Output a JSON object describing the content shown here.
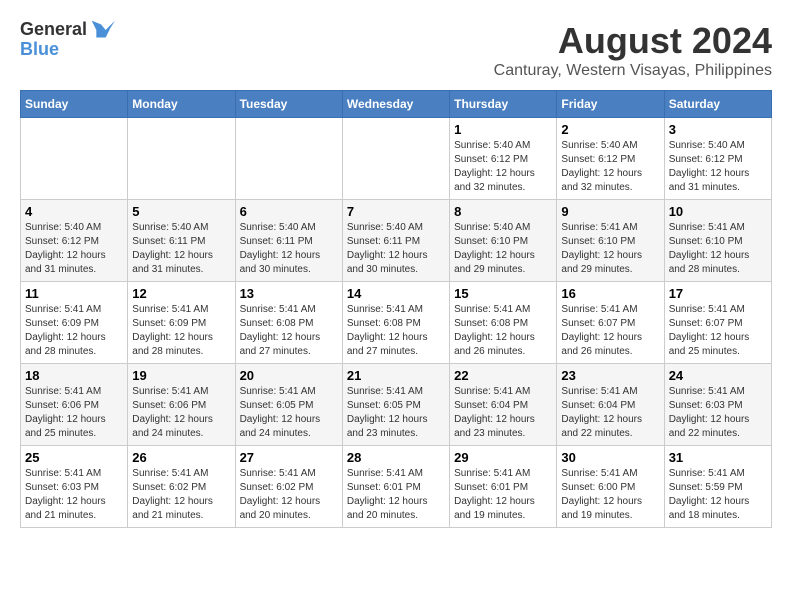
{
  "header": {
    "logo_line1": "General",
    "logo_line2": "Blue",
    "month_year": "August 2024",
    "location": "Canturay, Western Visayas, Philippines"
  },
  "days_of_week": [
    "Sunday",
    "Monday",
    "Tuesday",
    "Wednesday",
    "Thursday",
    "Friday",
    "Saturday"
  ],
  "weeks": [
    [
      {
        "day": "",
        "info": ""
      },
      {
        "day": "",
        "info": ""
      },
      {
        "day": "",
        "info": ""
      },
      {
        "day": "",
        "info": ""
      },
      {
        "day": "1",
        "info": "Sunrise: 5:40 AM\nSunset: 6:12 PM\nDaylight: 12 hours\nand 32 minutes."
      },
      {
        "day": "2",
        "info": "Sunrise: 5:40 AM\nSunset: 6:12 PM\nDaylight: 12 hours\nand 32 minutes."
      },
      {
        "day": "3",
        "info": "Sunrise: 5:40 AM\nSunset: 6:12 PM\nDaylight: 12 hours\nand 31 minutes."
      }
    ],
    [
      {
        "day": "4",
        "info": "Sunrise: 5:40 AM\nSunset: 6:12 PM\nDaylight: 12 hours\nand 31 minutes."
      },
      {
        "day": "5",
        "info": "Sunrise: 5:40 AM\nSunset: 6:11 PM\nDaylight: 12 hours\nand 31 minutes."
      },
      {
        "day": "6",
        "info": "Sunrise: 5:40 AM\nSunset: 6:11 PM\nDaylight: 12 hours\nand 30 minutes."
      },
      {
        "day": "7",
        "info": "Sunrise: 5:40 AM\nSunset: 6:11 PM\nDaylight: 12 hours\nand 30 minutes."
      },
      {
        "day": "8",
        "info": "Sunrise: 5:40 AM\nSunset: 6:10 PM\nDaylight: 12 hours\nand 29 minutes."
      },
      {
        "day": "9",
        "info": "Sunrise: 5:41 AM\nSunset: 6:10 PM\nDaylight: 12 hours\nand 29 minutes."
      },
      {
        "day": "10",
        "info": "Sunrise: 5:41 AM\nSunset: 6:10 PM\nDaylight: 12 hours\nand 28 minutes."
      }
    ],
    [
      {
        "day": "11",
        "info": "Sunrise: 5:41 AM\nSunset: 6:09 PM\nDaylight: 12 hours\nand 28 minutes."
      },
      {
        "day": "12",
        "info": "Sunrise: 5:41 AM\nSunset: 6:09 PM\nDaylight: 12 hours\nand 28 minutes."
      },
      {
        "day": "13",
        "info": "Sunrise: 5:41 AM\nSunset: 6:08 PM\nDaylight: 12 hours\nand 27 minutes."
      },
      {
        "day": "14",
        "info": "Sunrise: 5:41 AM\nSunset: 6:08 PM\nDaylight: 12 hours\nand 27 minutes."
      },
      {
        "day": "15",
        "info": "Sunrise: 5:41 AM\nSunset: 6:08 PM\nDaylight: 12 hours\nand 26 minutes."
      },
      {
        "day": "16",
        "info": "Sunrise: 5:41 AM\nSunset: 6:07 PM\nDaylight: 12 hours\nand 26 minutes."
      },
      {
        "day": "17",
        "info": "Sunrise: 5:41 AM\nSunset: 6:07 PM\nDaylight: 12 hours\nand 25 minutes."
      }
    ],
    [
      {
        "day": "18",
        "info": "Sunrise: 5:41 AM\nSunset: 6:06 PM\nDaylight: 12 hours\nand 25 minutes."
      },
      {
        "day": "19",
        "info": "Sunrise: 5:41 AM\nSunset: 6:06 PM\nDaylight: 12 hours\nand 24 minutes."
      },
      {
        "day": "20",
        "info": "Sunrise: 5:41 AM\nSunset: 6:05 PM\nDaylight: 12 hours\nand 24 minutes."
      },
      {
        "day": "21",
        "info": "Sunrise: 5:41 AM\nSunset: 6:05 PM\nDaylight: 12 hours\nand 23 minutes."
      },
      {
        "day": "22",
        "info": "Sunrise: 5:41 AM\nSunset: 6:04 PM\nDaylight: 12 hours\nand 23 minutes."
      },
      {
        "day": "23",
        "info": "Sunrise: 5:41 AM\nSunset: 6:04 PM\nDaylight: 12 hours\nand 22 minutes."
      },
      {
        "day": "24",
        "info": "Sunrise: 5:41 AM\nSunset: 6:03 PM\nDaylight: 12 hours\nand 22 minutes."
      }
    ],
    [
      {
        "day": "25",
        "info": "Sunrise: 5:41 AM\nSunset: 6:03 PM\nDaylight: 12 hours\nand 21 minutes."
      },
      {
        "day": "26",
        "info": "Sunrise: 5:41 AM\nSunset: 6:02 PM\nDaylight: 12 hours\nand 21 minutes."
      },
      {
        "day": "27",
        "info": "Sunrise: 5:41 AM\nSunset: 6:02 PM\nDaylight: 12 hours\nand 20 minutes."
      },
      {
        "day": "28",
        "info": "Sunrise: 5:41 AM\nSunset: 6:01 PM\nDaylight: 12 hours\nand 20 minutes."
      },
      {
        "day": "29",
        "info": "Sunrise: 5:41 AM\nSunset: 6:01 PM\nDaylight: 12 hours\nand 19 minutes."
      },
      {
        "day": "30",
        "info": "Sunrise: 5:41 AM\nSunset: 6:00 PM\nDaylight: 12 hours\nand 19 minutes."
      },
      {
        "day": "31",
        "info": "Sunrise: 5:41 AM\nSunset: 5:59 PM\nDaylight: 12 hours\nand 18 minutes."
      }
    ]
  ]
}
